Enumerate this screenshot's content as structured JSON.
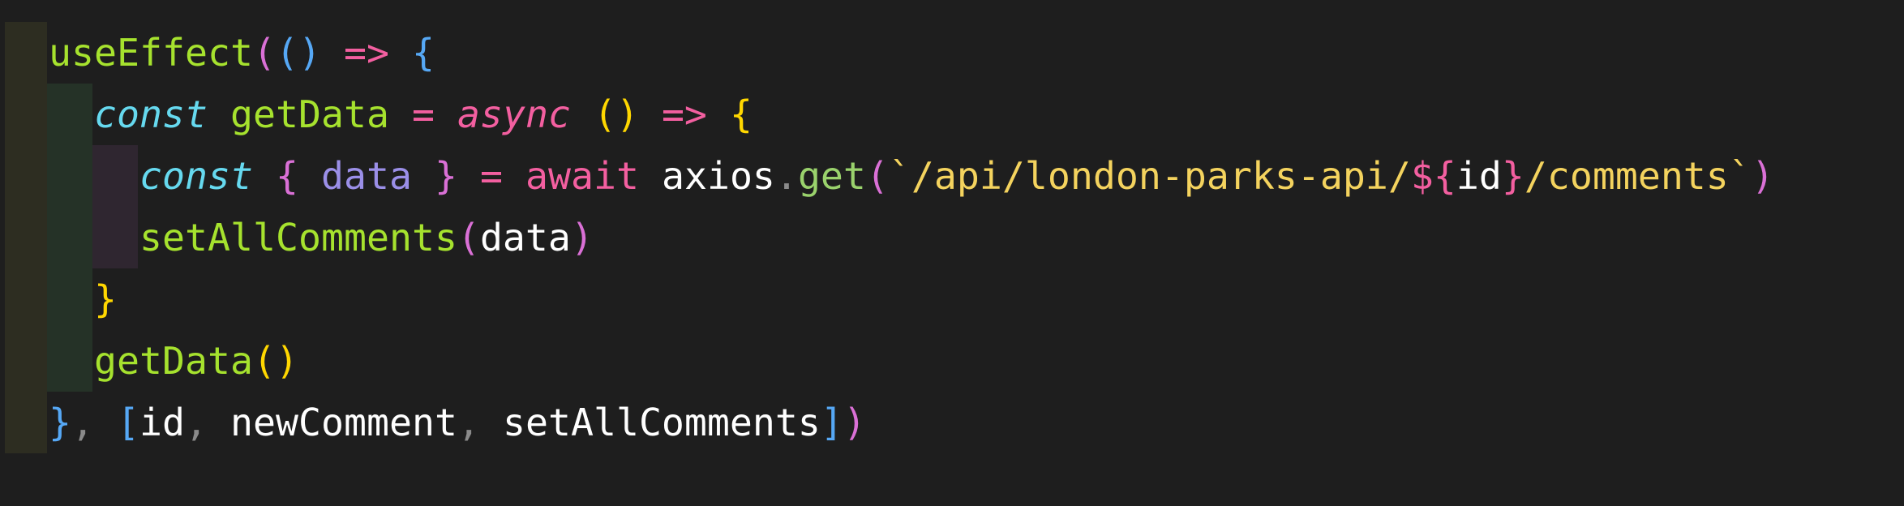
{
  "editor": {
    "colors": {
      "background": "#1e1e1e",
      "function": "#a6e22e",
      "keyword_italic": "#66d9ef",
      "async_await": "#f35fa0",
      "string": "#f4d35e",
      "bracket_yellow": "#ffd700",
      "bracket_pink": "#da70d6",
      "bracket_blue": "#56a8f5"
    },
    "lines": [
      {
        "tokens": [
          "useEffect",
          "(",
          "()",
          " ",
          "=>",
          " ",
          "{"
        ]
      },
      {
        "tokens": [
          "const",
          " ",
          "getData",
          " ",
          "=",
          " ",
          "async",
          " ",
          "()",
          " ",
          "=>",
          " ",
          "{"
        ]
      },
      {
        "tokens": [
          "const",
          " ",
          "{",
          " ",
          "data",
          " ",
          "}",
          " ",
          "=",
          " ",
          "await",
          " ",
          "axios",
          ".",
          "get",
          "(",
          "`/api/london-parks-api/",
          "${",
          "id",
          "}",
          "/comments`",
          ")"
        ]
      },
      {
        "tokens": [
          "setAllComments",
          "(",
          "data",
          ")"
        ]
      },
      {
        "tokens": [
          "}"
        ]
      },
      {
        "tokens": [
          "getData",
          "()"
        ]
      },
      {
        "tokens": [
          "}",
          ",",
          " ",
          "[",
          "id",
          ",",
          " ",
          "newComment",
          ",",
          " ",
          "setAllComments",
          "]",
          ")"
        ]
      }
    ]
  }
}
